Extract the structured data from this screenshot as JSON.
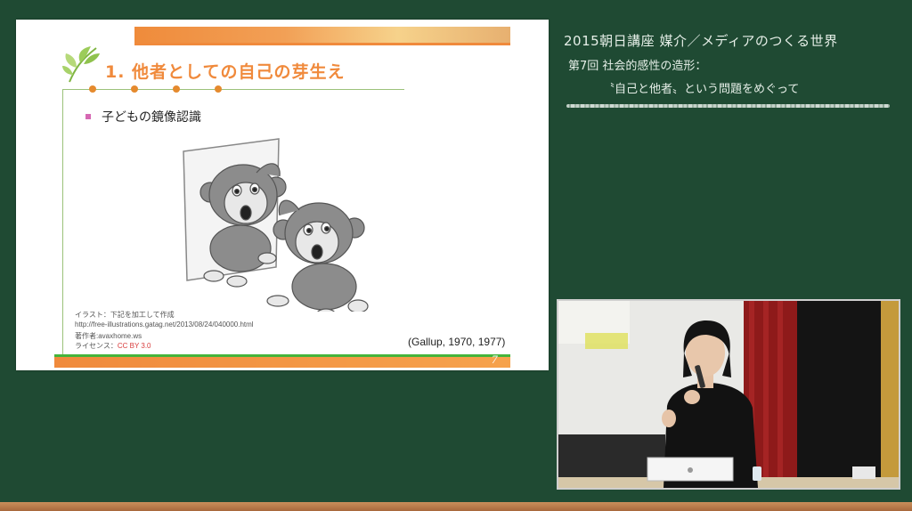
{
  "slide": {
    "title": "1. 他者としての自己の芽生え",
    "bullet": "子どもの鏡像認識",
    "credits": {
      "line1": "イラスト：下記を加工して作成",
      "line2": "http://free-illustrations.gatag.net/2013/08/24/040000.html",
      "line3": "著作者:avaxhome.ws",
      "license_label": "ライセンス：",
      "license": "CC BY 3.0"
    },
    "citation": "(Gallup, 1970, 1977)",
    "page_number": "7"
  },
  "board": {
    "course_title": "2015朝日講座 媒介／メディアのつくる世界",
    "lecture_title": "第7回 社会的感性の造形：",
    "lecture_subtitle": "〝自己と他者〟という問題をめぐって"
  },
  "icons": {
    "leaf": "leaf-icon",
    "monkey": "monkey-mirror-illustration"
  },
  "colors": {
    "board": "#1f4a33",
    "slide_accent": "#f08a3c",
    "slide_green": "#45b43b",
    "bullet": "#d668b3",
    "license_red": "#d83c3c"
  }
}
